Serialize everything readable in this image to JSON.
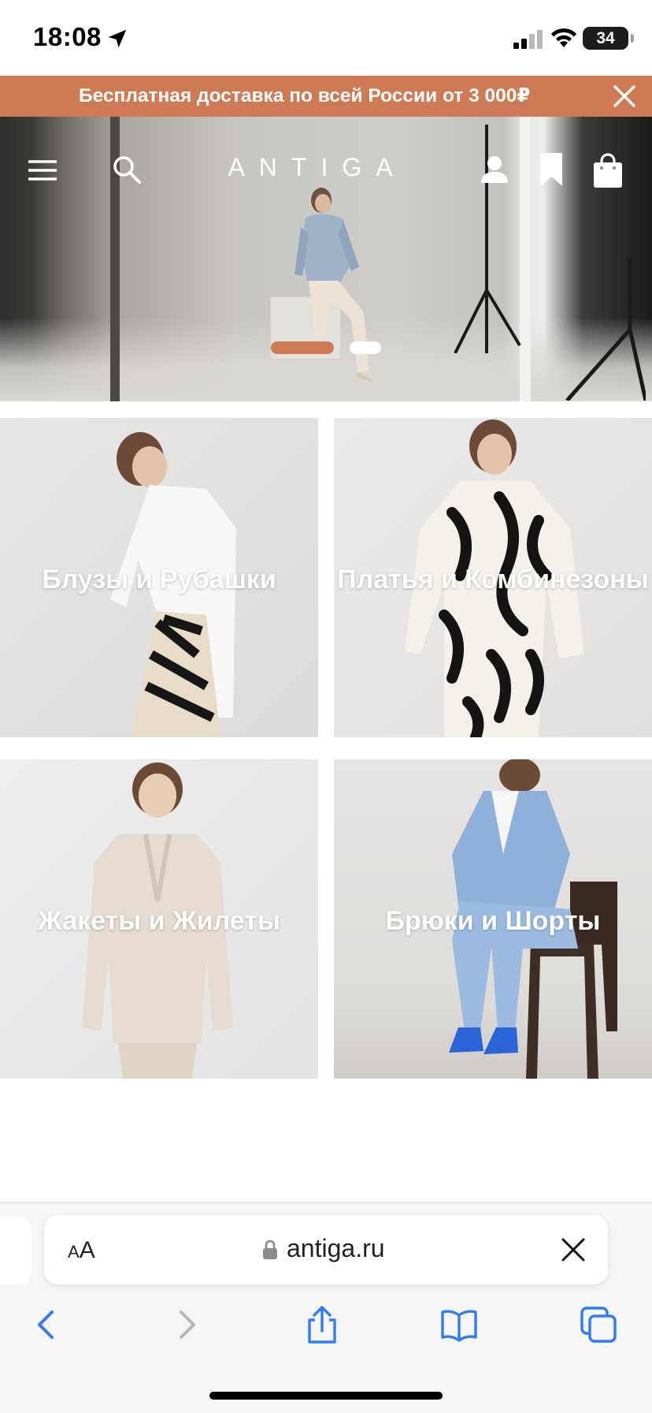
{
  "status_bar": {
    "time": "18:08",
    "battery": "34",
    "icons": [
      "location-arrow-icon",
      "cellular-signal-icon",
      "wifi-icon",
      "battery-icon"
    ]
  },
  "promo": {
    "text": "Бесплатная доставка по всей России от 3 000₽",
    "close_icon": "close-icon",
    "color": "#cf7a55"
  },
  "header": {
    "logo": "ANTIGA",
    "icons": [
      "menu-icon",
      "search-icon",
      "user-icon",
      "bookmark-icon",
      "shopping-bag-icon"
    ]
  },
  "hero": {
    "slides_total": 2,
    "active_slide": 1,
    "accent": "#cf7a55"
  },
  "categories": [
    {
      "label": "Блузы и Рубашки"
    },
    {
      "label": "Платья и Комбинезоны"
    },
    {
      "label": "Жакеты и Жилеты"
    },
    {
      "label": "Брюки и Шорты"
    }
  ],
  "safari": {
    "aa_small": "A",
    "aa_large": "A",
    "url": "antiga.ru",
    "toolbar_icons": [
      "back-icon",
      "forward-icon",
      "share-icon",
      "bookmarks-icon",
      "tabs-icon"
    ],
    "accent": "#2f7cf6"
  }
}
